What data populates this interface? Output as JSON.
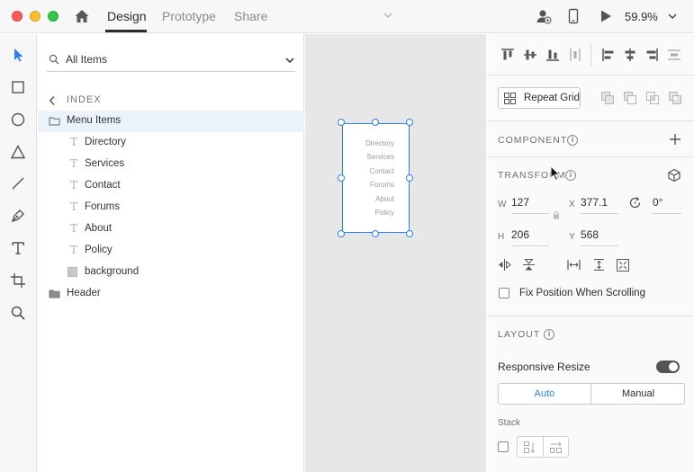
{
  "titlebar": {
    "tabs": {
      "design": "Design",
      "prototype": "Prototype",
      "share": "Share"
    },
    "zoom": "59.9%"
  },
  "layers": {
    "search_value": "All Items",
    "breadcrumb": "INDEX",
    "rows": {
      "menu_items": "Menu Items",
      "directory": "Directory",
      "services": "Services",
      "contact": "Contact",
      "forums": "Forums",
      "about": "About",
      "policy": "Policy",
      "background": "background",
      "header": "Header"
    }
  },
  "artboard": {
    "items": [
      "Directory",
      "Services",
      "Contact",
      "Forums",
      "About",
      "Policy"
    ]
  },
  "properties": {
    "repeat_grid": "Repeat Grid",
    "component_title": "COMPONENT",
    "transform_title": "TRANSFORM",
    "w_label": "W",
    "w_value": "127",
    "x_label": "X",
    "x_value": "377.1",
    "h_label": "H",
    "h_value": "206",
    "y_label": "Y",
    "y_value": "568",
    "rotation": "0°",
    "fix_position": "Fix Position When Scrolling",
    "layout_title": "LAYOUT",
    "responsive_resize": "Responsive Resize",
    "responsive_resize_on": true,
    "resize_mode": {
      "auto": "Auto",
      "manual": "Manual",
      "selected": "Auto"
    },
    "stack_label": "Stack"
  },
  "colors": {
    "accent": "#2d7ff0",
    "selection_bg": "#eaf2fb"
  }
}
